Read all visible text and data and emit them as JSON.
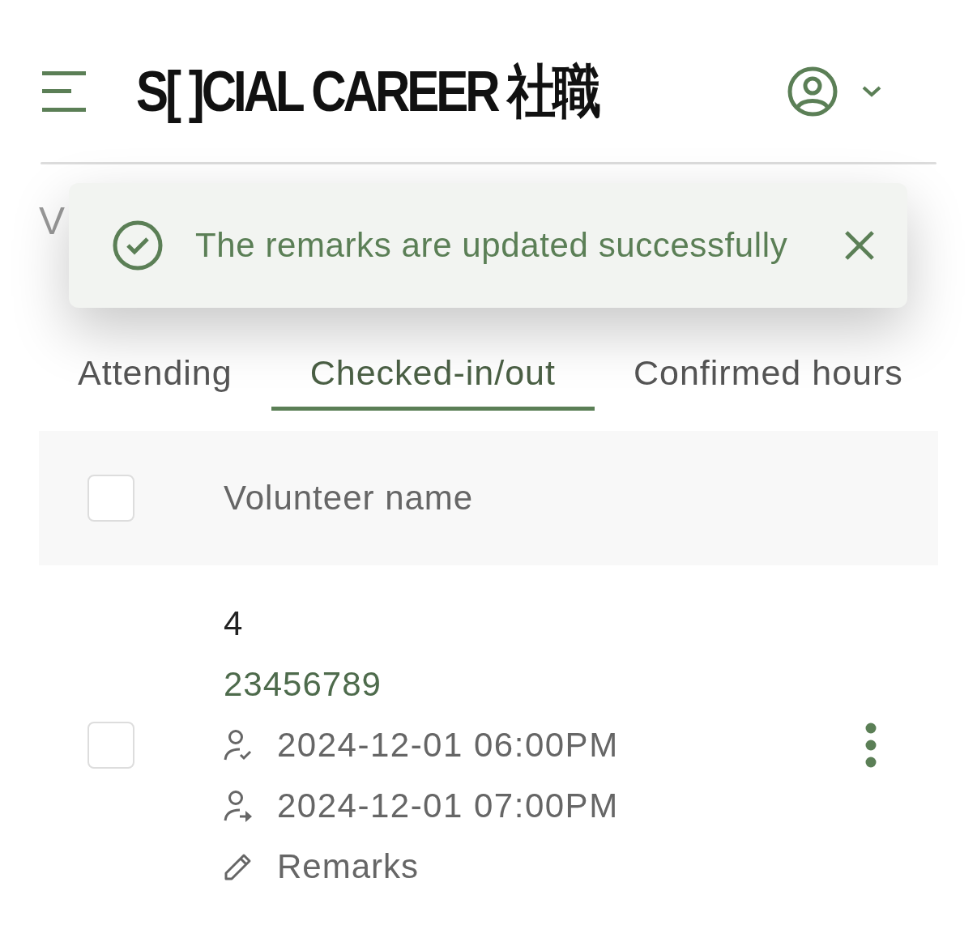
{
  "header": {
    "logo": "S[ ]CIAL CAREER 社職"
  },
  "page_title": "V",
  "toast": {
    "message": "The remarks are updated successfully"
  },
  "tabs": [
    {
      "label": "Attending",
      "selected": false
    },
    {
      "label": "Checked-in/out",
      "selected": true
    },
    {
      "label": "Confirmed hours",
      "selected": false
    }
  ],
  "table": {
    "header": {
      "checked": false,
      "column": "Volunteer name"
    },
    "rows": [
      {
        "checked": false,
        "name": "4",
        "phone": "23456789",
        "check_in": "2024-12-01 06:00PM",
        "check_out": "2024-12-01 07:00PM",
        "remarks": "Remarks"
      }
    ]
  }
}
